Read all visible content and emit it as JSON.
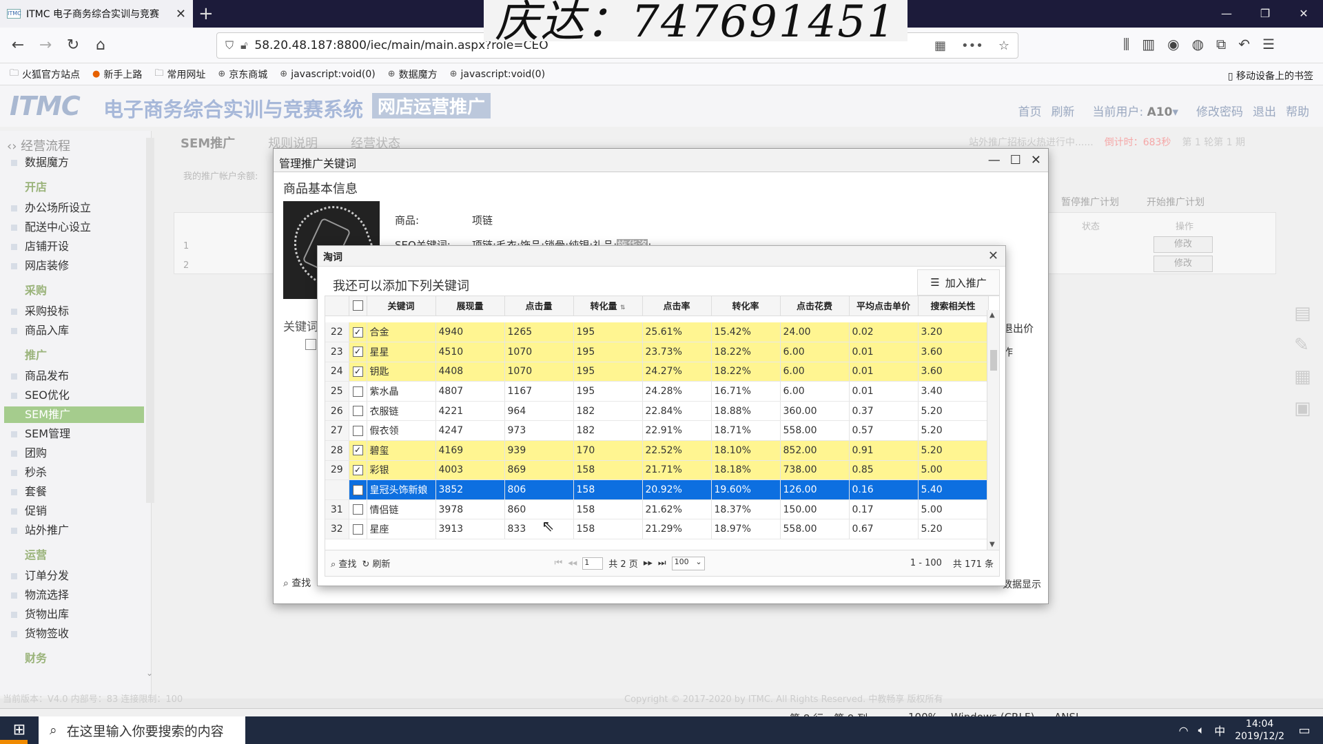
{
  "browser": {
    "tab_title": "ITMC 电子商务综合实训与竞赛",
    "favicon_text": "ITMC",
    "url": "58.20.48.187:8800/iec/main/main.aspx?role=CEO",
    "bookmarks": [
      "火狐官方站点",
      "新手上路",
      "常用网址",
      "京东商城",
      "javascript:void(0)",
      "数据魔方",
      "javascript:void(0)"
    ],
    "mobile_bookmarks": "移动设备上的书签"
  },
  "overlay_text": "庆达：747691451",
  "app": {
    "logo": "ITMC",
    "title": "电子商务综合实训与竞赛系统",
    "badge": "网店运营推广",
    "header_links": [
      "首页",
      "刷新"
    ],
    "current_user_label": "当前用户:",
    "current_user": "A10",
    "header_links2": [
      "修改密码",
      "退出",
      "帮助"
    ],
    "main_tabs": [
      "SEM推广",
      "规则说明",
      "经营状态"
    ],
    "status_text": "站外推广招标火热进行中......",
    "countdown": "倒计时：683秒",
    "round": "第 1 轮第 1 期",
    "balance_label": "我的推广帐户余额:",
    "bg_buttons": [
      "暂停推广计划",
      "开始推广计划"
    ],
    "bg_cols": [
      "状态",
      "操作"
    ],
    "bg_rows": [
      "1",
      "2"
    ],
    "bg_row_btn": "修改",
    "footer_left": "当前版本：V4.0 内部号：83 连接限制：100",
    "footer_center": "Copyright © 2017-2020 by ITMC. All Rights Reserved. 中教畅享 版权所有"
  },
  "sidebar": {
    "header": "经营流程",
    "items": [
      {
        "label": "数据魔方",
        "type": "sub"
      },
      {
        "label": "开店",
        "type": "grp"
      },
      {
        "label": "办公场所设立",
        "type": "sub"
      },
      {
        "label": "配送中心设立",
        "type": "sub"
      },
      {
        "label": "店铺开设",
        "type": "sub"
      },
      {
        "label": "网店装修",
        "type": "sub"
      },
      {
        "label": "采购",
        "type": "grp"
      },
      {
        "label": "采购投标",
        "type": "sub"
      },
      {
        "label": "商品入库",
        "type": "sub"
      },
      {
        "label": "推广",
        "type": "grp"
      },
      {
        "label": "商品发布",
        "type": "sub"
      },
      {
        "label": "SEO优化",
        "type": "sub"
      },
      {
        "label": "SEM推广",
        "type": "act"
      },
      {
        "label": "SEM管理",
        "type": "sub"
      },
      {
        "label": "团购",
        "type": "sub"
      },
      {
        "label": "秒杀",
        "type": "sub"
      },
      {
        "label": "套餐",
        "type": "sub"
      },
      {
        "label": "促销",
        "type": "sub"
      },
      {
        "label": "站外推广",
        "type": "sub"
      },
      {
        "label": "运营",
        "type": "grp"
      },
      {
        "label": "订单分发",
        "type": "sub"
      },
      {
        "label": "物流选择",
        "type": "sub"
      },
      {
        "label": "货物出库",
        "type": "sub"
      },
      {
        "label": "货物签收",
        "type": "sub"
      },
      {
        "label": "财务",
        "type": "grp"
      }
    ]
  },
  "dialog1": {
    "title": "管理推广关键词",
    "section": "商品基本信息",
    "product_label": "商品:",
    "product_value": "项链",
    "seo_label": "SEO关键词:",
    "seo_value": "项链;毛衣;饰品;锁骨;纯银;礼品;",
    "seo_highlight": "施华洛",
    "seo_tail": ";",
    "kw_title": "关键词",
    "right_text": "退出价",
    "right_text2": "作",
    "search": "查找",
    "footer_right": "数据显示"
  },
  "dialog2": {
    "title": "淘词",
    "subtitle": "我还可以添加下列关键词",
    "add_button": "加入推广",
    "columns": [
      "关键词",
      "展现量",
      "点击量",
      "转化量",
      "点击率",
      "转化率",
      "点击花费",
      "平均点击单价",
      "搜索相关性"
    ],
    "rows": [
      {
        "n": "22",
        "checked": true,
        "state": "yel",
        "kw": "合金",
        "show": "4940",
        "click": "1265",
        "conv": "195",
        "ctr": "25.61%",
        "cvr": "15.42%",
        "cost": "24.00",
        "avg": "0.02",
        "rel": "3.20"
      },
      {
        "n": "23",
        "checked": true,
        "state": "yel",
        "kw": "星星",
        "show": "4510",
        "click": "1070",
        "conv": "195",
        "ctr": "23.73%",
        "cvr": "18.22%",
        "cost": "6.00",
        "avg": "0.01",
        "rel": "3.60"
      },
      {
        "n": "24",
        "checked": true,
        "state": "yel",
        "kw": "钥匙",
        "show": "4408",
        "click": "1070",
        "conv": "195",
        "ctr": "24.27%",
        "cvr": "18.22%",
        "cost": "6.00",
        "avg": "0.01",
        "rel": "3.60"
      },
      {
        "n": "25",
        "checked": false,
        "state": "",
        "kw": "紫水晶",
        "show": "4807",
        "click": "1167",
        "conv": "195",
        "ctr": "24.28%",
        "cvr": "16.71%",
        "cost": "6.00",
        "avg": "0.01",
        "rel": "3.40"
      },
      {
        "n": "26",
        "checked": false,
        "state": "",
        "kw": "衣服链",
        "show": "4221",
        "click": "964",
        "conv": "182",
        "ctr": "22.84%",
        "cvr": "18.88%",
        "cost": "360.00",
        "avg": "0.37",
        "rel": "5.20"
      },
      {
        "n": "27",
        "checked": false,
        "state": "",
        "kw": "假衣领",
        "show": "4247",
        "click": "973",
        "conv": "182",
        "ctr": "22.91%",
        "cvr": "18.71%",
        "cost": "558.00",
        "avg": "0.57",
        "rel": "5.20"
      },
      {
        "n": "28",
        "checked": true,
        "state": "yel",
        "kw": "碧玺",
        "show": "4169",
        "click": "939",
        "conv": "170",
        "ctr": "22.52%",
        "cvr": "18.10%",
        "cost": "852.00",
        "avg": "0.91",
        "rel": "5.20"
      },
      {
        "n": "29",
        "checked": true,
        "state": "yel",
        "kw": "彩银",
        "show": "4003",
        "click": "869",
        "conv": "158",
        "ctr": "21.71%",
        "cvr": "18.18%",
        "cost": "738.00",
        "avg": "0.85",
        "rel": "5.00"
      },
      {
        "n": "",
        "checked": false,
        "state": "sel",
        "kw": "皇冠头饰新娘",
        "show": "3852",
        "click": "806",
        "conv": "158",
        "ctr": "20.92%",
        "cvr": "19.60%",
        "cost": "126.00",
        "avg": "0.16",
        "rel": "5.40"
      },
      {
        "n": "31",
        "checked": false,
        "state": "",
        "kw": "情侣链",
        "show": "3978",
        "click": "860",
        "conv": "158",
        "ctr": "21.62%",
        "cvr": "18.37%",
        "cost": "150.00",
        "avg": "0.17",
        "rel": "5.00"
      },
      {
        "n": "32",
        "checked": false,
        "state": "",
        "kw": "星座",
        "show": "3913",
        "click": "833",
        "conv": "158",
        "ctr": "21.29%",
        "cvr": "18.97%",
        "cost": "558.00",
        "avg": "0.67",
        "rel": "5.20"
      }
    ],
    "pager": {
      "search": "查找",
      "refresh": "刷新",
      "page": "1",
      "total_pages": "共 2 页",
      "page_size": "100",
      "range": "1 - 100",
      "total": "共 171 条"
    }
  },
  "statusbar": {
    "position": "第 8 行，第 9 列",
    "zoom": "100%",
    "line_ending": "Windows (CRLF)",
    "encoding": "ANSI"
  },
  "taskbar": {
    "search_placeholder": "在这里输入你要搜索的内容",
    "ime": "中",
    "time": "14:04",
    "date": "2019/12/2"
  }
}
